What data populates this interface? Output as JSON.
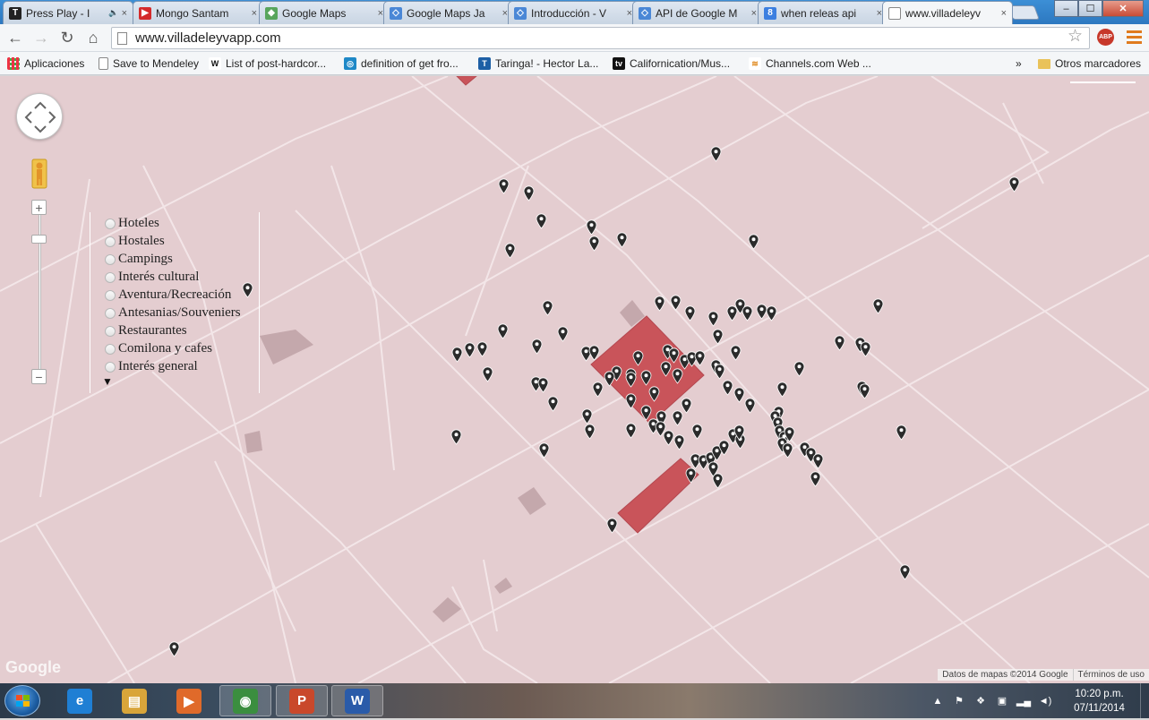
{
  "browser": {
    "tabs": [
      {
        "title": "Press Play - I",
        "icon": "nyt-icon",
        "extra": "speaker-icon"
      },
      {
        "title": "Mongo Santam",
        "icon": "youtube-icon"
      },
      {
        "title": "Google Maps",
        "icon": "maps-icon"
      },
      {
        "title": "Google Maps Ja",
        "icon": "google-dev-icon"
      },
      {
        "title": "Introducción - V",
        "icon": "google-dev-icon"
      },
      {
        "title": "API de Google M",
        "icon": "google-dev-icon"
      },
      {
        "title": "when releas api",
        "icon": "google-search-icon"
      },
      {
        "title": "www.villadeleyv",
        "icon": "page-icon",
        "active": true
      }
    ],
    "close_glyph": "×",
    "window_controls": {
      "minimize": "–",
      "maximize": "☐",
      "close": "✕"
    },
    "toolbar": {
      "back": "←",
      "forward": "→",
      "reload": "↻",
      "home": "⌂"
    },
    "url": "www.villadeleyvapp.com",
    "star": "☆",
    "abp_label": "ABP"
  },
  "bookmarks": {
    "items": [
      {
        "label": "Aplicaciones",
        "icon": "apps-grid-icon"
      },
      {
        "label": "Save to Mendeley",
        "icon": "page-icon"
      },
      {
        "label": "List of post-hardcor...",
        "icon": "wikipedia-icon",
        "glyph": "W"
      },
      {
        "label": "definition of get fro...",
        "icon": "oxford-icon",
        "glyph": "◎"
      },
      {
        "label": "Taringa! - Hector La...",
        "icon": "taringa-icon",
        "glyph": "T"
      },
      {
        "label": "Californication/Mus...",
        "icon": "tv-icon",
        "glyph": "tv"
      },
      {
        "label": "Channels.com Web ...",
        "icon": "rss-icon",
        "glyph": "≋"
      }
    ],
    "overflow": "»",
    "other": "Otros marcadores"
  },
  "map": {
    "filters": [
      "Hoteles",
      "Hostales",
      "Campings",
      "Interés cultural",
      "Aventura/Recreación",
      "Antesanias/Souveniers",
      "Restaurantes",
      "Comilona y cafes",
      "Interés general"
    ],
    "expand_arrow": "▼",
    "zoom_in": "+",
    "zoom_out": "−",
    "watermark": "Google",
    "map_data_credit": "Datos de mapas ©2014 Google",
    "terms": "Términos de uso",
    "colors": {
      "background": "#e4cdd0",
      "road": "#f3e6e8",
      "highlight": "#c9545a",
      "building": "#c4a8ac",
      "marker": "#2b2b2b"
    }
  },
  "taskbar": {
    "apps": [
      {
        "name": "internet-explorer",
        "glyph": "e",
        "color": "#1f7fd4"
      },
      {
        "name": "file-explorer",
        "glyph": "▤",
        "color": "#d9a53a"
      },
      {
        "name": "media-player",
        "glyph": "▶",
        "color": "#e06a2a"
      },
      {
        "name": "chrome",
        "glyph": "◉",
        "color": "#3b8e3f",
        "open": true
      },
      {
        "name": "powerpoint",
        "glyph": "P",
        "color": "#c9482b",
        "open": true
      },
      {
        "name": "word",
        "glyph": "W",
        "color": "#2a5ba9",
        "open": true
      }
    ],
    "time": "10:20 p.m.",
    "date": "07/11/2014"
  }
}
